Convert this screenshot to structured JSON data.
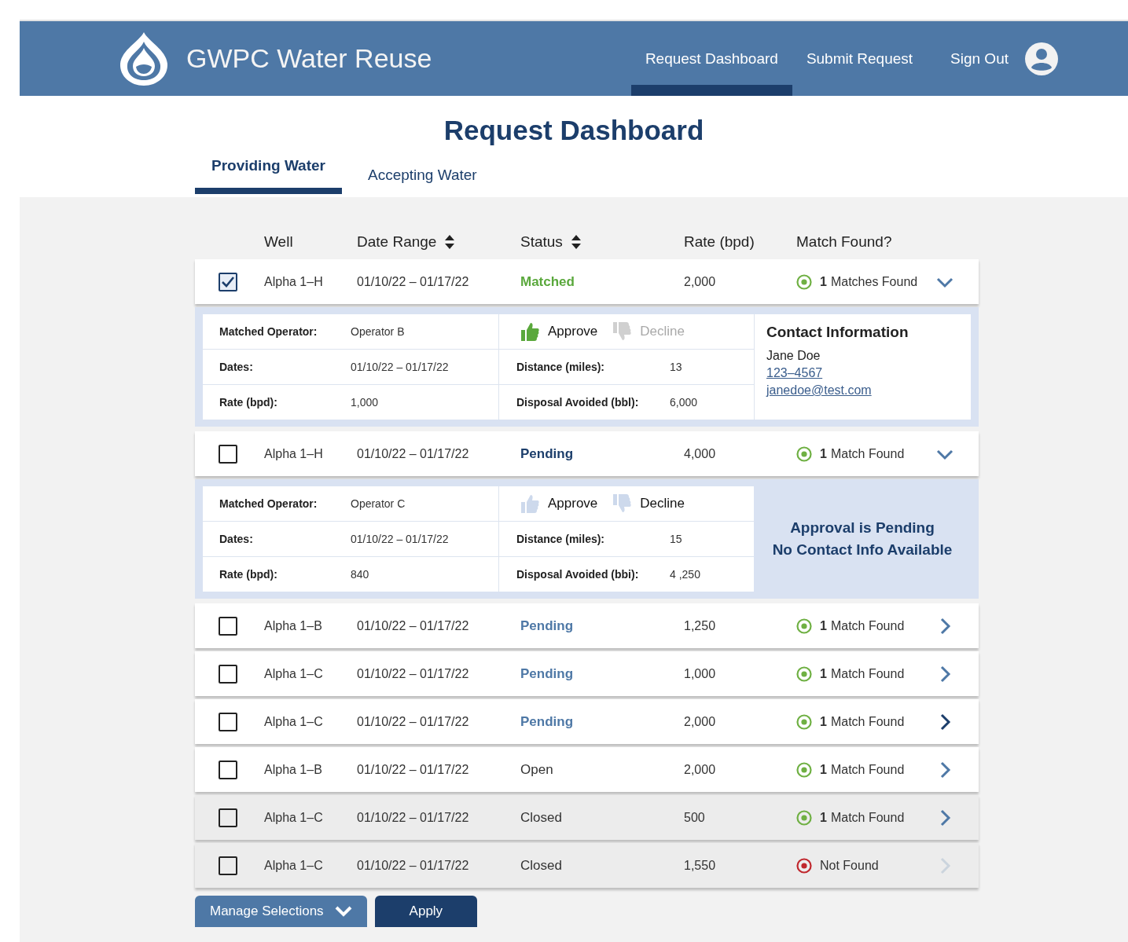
{
  "header": {
    "brand": "GWPC Water Reuse",
    "nav": [
      {
        "label": "Request Dashboard",
        "selected": true
      },
      {
        "label": "Submit Request",
        "selected": false
      },
      {
        "label": "Sign Out",
        "selected": false
      }
    ]
  },
  "title": "Request Dashboard",
  "tabs": [
    {
      "label": "Providing Water",
      "selected": true
    },
    {
      "label": "Accepting Water",
      "selected": false
    }
  ],
  "columns": [
    {
      "label": "Well",
      "sortable": false
    },
    {
      "label": "Date Range",
      "sortable": true
    },
    {
      "label": "Status",
      "sortable": true
    },
    {
      "label": "Rate (bpd)",
      "sortable": false
    },
    {
      "label": "Match Found?",
      "sortable": false
    }
  ],
  "rows": [
    {
      "checked": true,
      "well": "Alpha 1–H",
      "dates": "01/10/22 – 01/17/22",
      "status": {
        "label": "Matched",
        "color": "#5aa83c",
        "bold": true
      },
      "rate": "2,000",
      "found": true,
      "match_count": "1",
      "match_text": "Matches Found",
      "expanded": true,
      "closed": false,
      "chevron_active": false,
      "chevron_disabled": false,
      "detail": {
        "operator_label": "Matched Operator:",
        "operator": "Operator B",
        "dates_label": "Dates:",
        "dates": "01/10/22 – 01/17/22",
        "rate_label": "Rate (bpd):",
        "rate": "1,000",
        "approve": {
          "label": "Approve",
          "selected": true,
          "disabled": false
        },
        "decline": {
          "label": "Decline",
          "selected": false,
          "disabled": true
        },
        "distance_label": "Distance (miles):",
        "distance": "13",
        "disposal_label": "Disposal Avoided (bbl):",
        "disposal": "6,000",
        "side": {
          "kind": "contact",
          "title": "Contact Information",
          "name": "Jane Doe",
          "phone": "123–4567",
          "email": "janedoe@test.com"
        }
      }
    },
    {
      "checked": false,
      "well": "Alpha 1–H",
      "dates": "01/10/22 – 01/17/22",
      "status": {
        "label": "Pending",
        "color": "#1c3e6b",
        "bold": true
      },
      "rate": "4,000",
      "found": true,
      "match_count": "1",
      "match_text": "Match Found",
      "expanded": true,
      "closed": false,
      "chevron_active": false,
      "chevron_disabled": false,
      "detail": {
        "operator_label": "Matched Operator:",
        "operator": "Operator C",
        "dates_label": "Dates:",
        "dates": "01/10/22 – 01/17/22",
        "rate_label": "Rate (bpd):",
        "rate": "840",
        "approve": {
          "label": "Approve",
          "selected": false,
          "disabled": false
        },
        "decline": {
          "label": "Decline",
          "selected": false,
          "disabled": false
        },
        "distance_label": "Distance (miles):",
        "distance": "15",
        "disposal_label": "Disposal Avoided (bbi):",
        "disposal": "4 ,250",
        "side": {
          "kind": "pending",
          "lines": [
            "Approval is Pending",
            "No Contact Info Available"
          ]
        }
      }
    },
    {
      "checked": false,
      "well": "Alpha 1–B",
      "dates": "01/10/22 – 01/17/22",
      "status": {
        "label": "Pending",
        "color": "#4e78a6",
        "bold": true
      },
      "rate": "1,250",
      "found": true,
      "match_count": "1",
      "match_text": "Match Found",
      "expanded": false,
      "closed": false,
      "chevron_active": false,
      "chevron_disabled": false
    },
    {
      "checked": false,
      "well": "Alpha 1–C",
      "dates": "01/10/22 – 01/17/22",
      "status": {
        "label": "Pending",
        "color": "#4e78a6",
        "bold": true
      },
      "rate": "1,000",
      "found": true,
      "match_count": "1",
      "match_text": "Match Found",
      "expanded": false,
      "closed": false,
      "chevron_active": false,
      "chevron_disabled": false
    },
    {
      "checked": false,
      "well": "Alpha 1–C",
      "dates": "01/10/22 – 01/17/22",
      "status": {
        "label": "Pending",
        "color": "#4e78a6",
        "bold": true
      },
      "rate": "2,000",
      "found": true,
      "match_count": "1",
      "match_text": "Match Found",
      "expanded": false,
      "closed": false,
      "chevron_active": true,
      "chevron_disabled": false
    },
    {
      "checked": false,
      "well": "Alpha 1–B",
      "dates": "01/10/22 – 01/17/22",
      "status": {
        "label": "Open",
        "color": "#333333",
        "bold": false
      },
      "rate": "2,000",
      "found": true,
      "match_count": "1",
      "match_text": "Match Found",
      "expanded": false,
      "closed": false,
      "chevron_active": false,
      "chevron_disabled": false
    },
    {
      "checked": false,
      "well": "Alpha 1–C",
      "dates": "01/10/22 – 01/17/22",
      "status": {
        "label": "Closed",
        "color": "#333333",
        "bold": false
      },
      "rate": "500",
      "found": true,
      "match_count": "1",
      "match_text": "Match Found",
      "expanded": false,
      "closed": true,
      "chevron_active": false,
      "chevron_disabled": false
    },
    {
      "checked": false,
      "well": "Alpha 1–C",
      "dates": "01/10/22 – 01/17/22",
      "status": {
        "label": "Closed",
        "color": "#333333",
        "bold": false
      },
      "rate": "1,550",
      "found": false,
      "match_text": "Not Found",
      "expanded": false,
      "closed": true,
      "chevron_active": false,
      "chevron_disabled": true
    }
  ],
  "buttons": [
    {
      "label": "Manage Selections",
      "kind": "menu"
    },
    {
      "label": "Apply",
      "kind": "primary"
    }
  ]
}
